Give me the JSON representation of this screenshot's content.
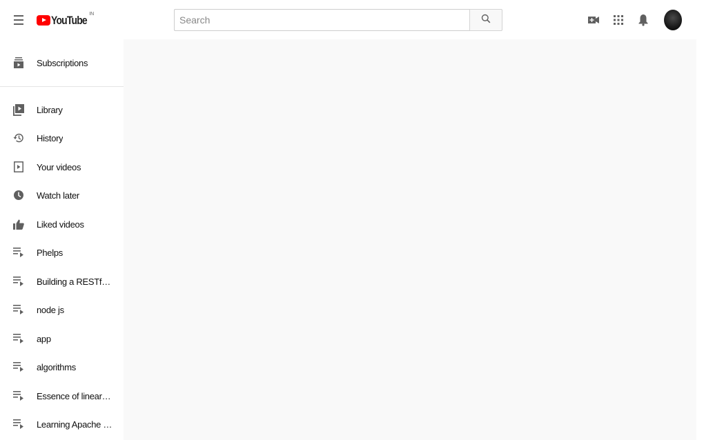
{
  "header": {
    "logo_text": "YouTube",
    "country_code": "IN",
    "search": {
      "placeholder": "Search",
      "value": ""
    }
  },
  "icons": {
    "menu": "hamburger-menu-icon",
    "search": "search-icon",
    "create": "video-camera-plus-icon",
    "apps": "apps-grid-icon",
    "notifications": "bell-icon",
    "avatar": "user-avatar"
  },
  "sidebar": {
    "items": [
      {
        "label": "Subscriptions",
        "icon": "subscriptions-icon"
      },
      {
        "label": "Library",
        "icon": "library-icon"
      },
      {
        "label": "History",
        "icon": "history-icon"
      },
      {
        "label": "Your videos",
        "icon": "your-videos-icon"
      },
      {
        "label": "Watch later",
        "icon": "clock-icon"
      },
      {
        "label": "Liked videos",
        "icon": "thumbs-up-icon"
      },
      {
        "label": "Phelps",
        "icon": "playlist-icon"
      },
      {
        "label": "Building a RESTful A...",
        "icon": "playlist-icon"
      },
      {
        "label": "node js",
        "icon": "playlist-icon"
      },
      {
        "label": "app",
        "icon": "playlist-icon"
      },
      {
        "label": "algorithms",
        "icon": "playlist-icon"
      },
      {
        "label": "Essence of linear alg...",
        "icon": "playlist-icon"
      },
      {
        "label": "Learning Apache HTT...",
        "icon": "playlist-icon"
      }
    ]
  },
  "colors": {
    "brand_red": "#ff0000",
    "main_background": "#f9f9f9",
    "icon_gray": "#606060"
  }
}
